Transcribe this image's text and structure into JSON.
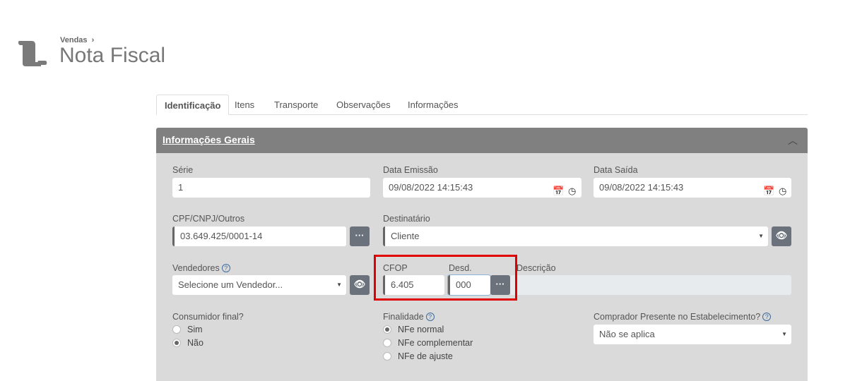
{
  "breadcrumb": "Vendas",
  "page_title": "Nota Fiscal",
  "tabs": [
    "Identificação",
    "Itens",
    "Transporte",
    "Observações",
    "Informações"
  ],
  "panel": {
    "title": "Informações Gerais"
  },
  "fields": {
    "serie": {
      "label": "Série",
      "value": "1"
    },
    "data_emissao": {
      "label": "Data Emissão",
      "value": "09/08/2022 14:15:43"
    },
    "data_saida": {
      "label": "Data Saída",
      "value": "09/08/2022 14:15:43"
    },
    "cpf": {
      "label": "CPF/CNPJ/Outros",
      "value": "03.649.425/0001-14"
    },
    "destinatario": {
      "label": "Destinatário",
      "value": "Cliente"
    },
    "vendedores": {
      "label": "Vendedores",
      "placeholder": "Selecione um Vendedor..."
    },
    "cfop": {
      "label": "CFOP",
      "value": "6.405"
    },
    "desd": {
      "label": "Desd.",
      "value": "000"
    },
    "descricao": {
      "label": "Descrição",
      "value": ""
    },
    "consumidor": {
      "label": "Consumidor final?",
      "options": [
        "Sim",
        "Não"
      ],
      "selected": "Não"
    },
    "finalidade": {
      "label": "Finalidade",
      "options": [
        "NFe normal",
        "NFe complementar",
        "NFe de ajuste"
      ],
      "selected": "NFe normal"
    },
    "comprador": {
      "label": "Comprador Presente no Estabelecimento?",
      "value": "Não se aplica"
    }
  },
  "colors": {
    "header": "#808080",
    "body": "#dadada",
    "button": "#6b727b",
    "highlight": "#e00000"
  }
}
